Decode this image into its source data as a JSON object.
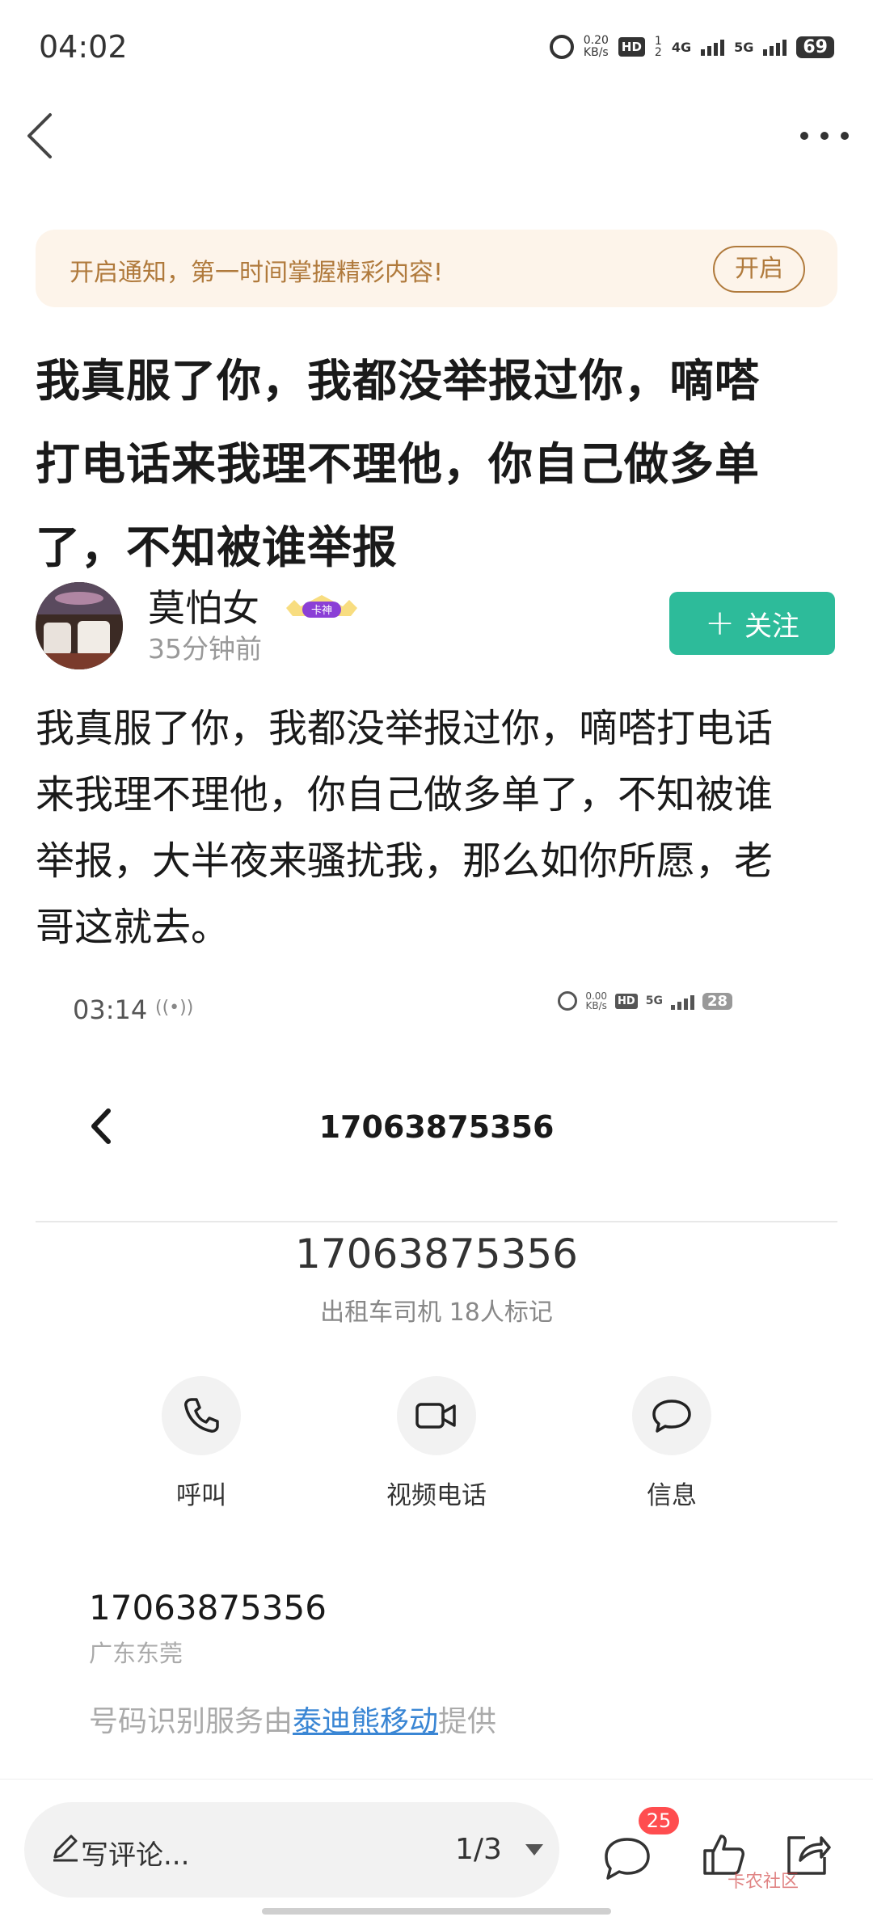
{
  "status_bar": {
    "time": "04:02",
    "speed_value": "0.20",
    "speed_unit": "KB/s",
    "hd": "HD",
    "hd_sub": "1",
    "hd_sub2": "2",
    "net1": "4G",
    "net2": "5G",
    "battery": "69"
  },
  "notice": {
    "text": "开启通知，第一时间掌握精彩内容!",
    "button": "开启"
  },
  "post": {
    "title_lines": [
      "我真服了你，我都没举报过你，嘀嗒",
      "打电话来我理不理他，你自己做多单",
      "了，不知被谁举报"
    ],
    "author": {
      "name": "莫怕女",
      "badge": "卡神",
      "time": "35分钟前",
      "follow_label": "关注"
    },
    "body_lines": [
      "我真服了你，我都没举报过你，嘀嗒打电话",
      "来我理不理他，你自己做多单了，不知被谁",
      "举报，大半夜来骚扰我，那么如你所愿，老",
      "哥这就去。"
    ]
  },
  "embed": {
    "time": "03:14",
    "speed_value": "0.00",
    "speed_unit": "KB/s",
    "hd": "HD",
    "net": "5G",
    "battery": "28",
    "title": "17063875356",
    "number": "17063875356",
    "tag": "出租车司机 18人标记",
    "actions": [
      {
        "label": "呼叫",
        "icon": "phone-icon"
      },
      {
        "label": "视频电话",
        "icon": "video-icon"
      },
      {
        "label": "信息",
        "icon": "message-icon"
      }
    ],
    "number2": "17063875356",
    "location": "广东东莞",
    "provider_prefix": "号码识别服务由",
    "provider_link": "泰迪熊移动",
    "provider_suffix": "提供"
  },
  "bottom_bar": {
    "comment_placeholder": "写评论...",
    "page_indicator": "1/3",
    "comment_count": "25",
    "watermark": "卡农社区"
  },
  "colors": {
    "accent": "#2dbb9a",
    "notice_bg": "#fdf4ea",
    "notice_text": "#b07a3c",
    "badge_red": "#ff4d4f",
    "link": "#3a86d4"
  }
}
